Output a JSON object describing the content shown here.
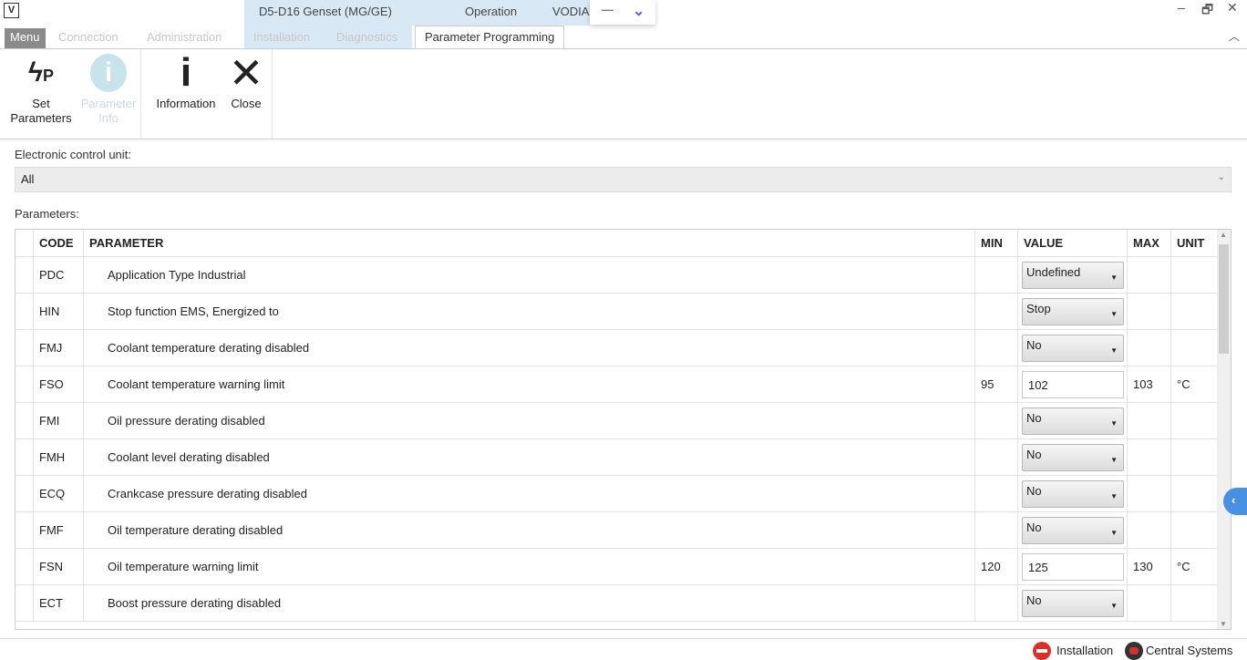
{
  "window": {
    "context_title": "D5-D16 Genset (MG/GE)",
    "operation": "Operation",
    "app": "VODIA",
    "minimize": "—",
    "restore": "🗗",
    "close": "✕",
    "logo": "V"
  },
  "tabs": [
    {
      "label": "Menu"
    },
    {
      "label": "Connection"
    },
    {
      "label": "Administration"
    },
    {
      "label": "Installation"
    },
    {
      "label": "Diagnostics"
    },
    {
      "label": "Parameter Programming"
    }
  ],
  "ribbon": {
    "set_parameters": "Set Parameters",
    "parameter_info": "Parameter Info",
    "information": "Information",
    "close": "Close"
  },
  "ecu": {
    "label": "Electronic control unit:",
    "value": "All"
  },
  "params_label": "Parameters:",
  "columns": {
    "code": "CODE",
    "parameter": "PARAMETER",
    "min": "MIN",
    "value": "VALUE",
    "max": "MAX",
    "unit": "UNIT"
  },
  "rows": [
    {
      "code": "PDC",
      "parameter": "Application Type Industrial",
      "min": "",
      "value": "Undefined",
      "type": "dropdown",
      "max": "",
      "unit": ""
    },
    {
      "code": "HIN",
      "parameter": "Stop function EMS, Energized to",
      "min": "",
      "value": "Stop",
      "type": "dropdown",
      "max": "",
      "unit": ""
    },
    {
      "code": "FMJ",
      "parameter": "Coolant temperature derating disabled",
      "min": "",
      "value": "No",
      "type": "dropdown",
      "max": "",
      "unit": ""
    },
    {
      "code": "FSO",
      "parameter": "Coolant temperature warning limit",
      "min": "95",
      "value": "102",
      "type": "input",
      "max": "103",
      "unit": "°C"
    },
    {
      "code": "FMI",
      "parameter": "Oil pressure derating disabled",
      "min": "",
      "value": "No",
      "type": "dropdown",
      "max": "",
      "unit": ""
    },
    {
      "code": "FMH",
      "parameter": "Coolant level derating disabled",
      "min": "",
      "value": "No",
      "type": "dropdown",
      "max": "",
      "unit": ""
    },
    {
      "code": "ECQ",
      "parameter": "Crankcase pressure derating disabled",
      "min": "",
      "value": "No",
      "type": "dropdown",
      "max": "",
      "unit": ""
    },
    {
      "code": "FMF",
      "parameter": "Oil temperature derating disabled",
      "min": "",
      "value": "No",
      "type": "dropdown",
      "max": "",
      "unit": ""
    },
    {
      "code": "FSN",
      "parameter": "Oil temperature warning limit",
      "min": "120",
      "value": "125",
      "type": "input",
      "max": "130",
      "unit": "°C"
    },
    {
      "code": "ECT",
      "parameter": "Boost pressure derating disabled",
      "min": "",
      "value": "No",
      "type": "dropdown",
      "max": "",
      "unit": ""
    }
  ],
  "status": {
    "installation": "Installation",
    "central": "Central Systems"
  }
}
